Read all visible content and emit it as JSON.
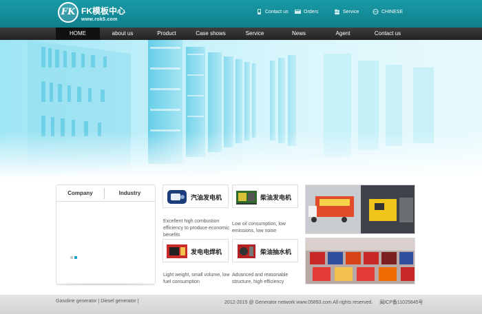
{
  "header": {
    "logo_mark": "FK",
    "logo_name": "FK模板中心",
    "logo_url": "www.rok5.com",
    "toplinks": [
      {
        "label": "Contact us",
        "icon": "phone-icon"
      },
      {
        "label": "Orders",
        "icon": "cart-icon"
      },
      {
        "label": "Service",
        "icon": "people-icon"
      },
      {
        "label": "CHINESE",
        "icon": "globe-icon"
      }
    ]
  },
  "nav": {
    "items": [
      {
        "label": "HOME",
        "active": true
      },
      {
        "label": "about us"
      },
      {
        "label": "Product"
      },
      {
        "label": "Case shows"
      },
      {
        "label": "Service"
      },
      {
        "label": "News"
      },
      {
        "label": "Agent"
      },
      {
        "label": "Contact us"
      }
    ]
  },
  "tabs": {
    "company": "Company",
    "industry": "Industry"
  },
  "products": [
    {
      "label": "汽油发电机",
      "desc": "Excellent high combustion efficiency to produce economic benefits"
    },
    {
      "label": "柴油发电机",
      "desc": "Low oil consumption, low emissions, low noise"
    },
    {
      "label": "发电电焊机",
      "desc": "Light weight, small volume, low fuel consumption"
    },
    {
      "label": "柴油抽水机",
      "desc": "Advanced and reasonable structure, high efficiency"
    }
  ],
  "footer": {
    "links": "Gasoline generator | Diesel generator |",
    "copyright": "2012-2015 @ Generator network www.05893.com All rights reserved.",
    "icp": "闽ICP备11025845号"
  },
  "colors": {
    "header": "#1597a3",
    "nav": "#2c2c2c",
    "accent": "#1aa0c6"
  }
}
